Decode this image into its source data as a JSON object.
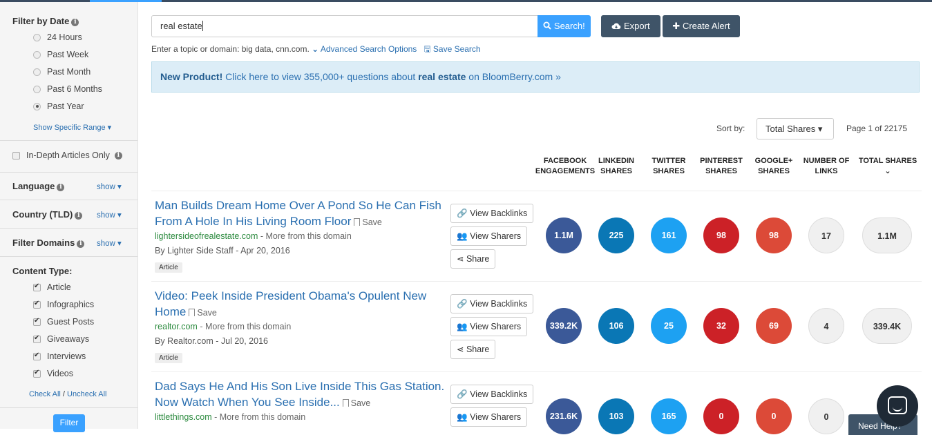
{
  "sidebar": {
    "date_heading": "Filter by Date",
    "date_options": [
      {
        "label": "24 Hours",
        "selected": false
      },
      {
        "label": "Past Week",
        "selected": false
      },
      {
        "label": "Past Month",
        "selected": false
      },
      {
        "label": "Past 6 Months",
        "selected": false
      },
      {
        "label": "Past Year",
        "selected": true
      }
    ],
    "show_range": "Show Specific Range ▾",
    "in_depth": "In-Depth Articles Only",
    "language": "Language",
    "country": "Country (TLD)",
    "filter_domains": "Filter Domains",
    "show": "show ▾",
    "content_type_heading": "Content Type:",
    "content_types": [
      "Article",
      "Infographics",
      "Guest Posts",
      "Giveaways",
      "Interviews",
      "Videos"
    ],
    "check_all": "Check All",
    "slash": " / ",
    "uncheck_all": "Uncheck All",
    "filter_button": "Filter"
  },
  "search": {
    "query": "real estate",
    "button": "Search!",
    "export": "Export",
    "create_alert": "Create Alert",
    "hint": "Enter a topic or domain: big data, cnn.com.",
    "advanced": "Advanced Search Options",
    "save": "Save Search"
  },
  "banner": {
    "new_product": "New Product!",
    "text_before": " Click here to view 355,000+ questions about ",
    "topic": "real estate",
    "text_after": " on BloomBerry.com »"
  },
  "sort": {
    "label": "Sort by:",
    "value": "Total Shares ▾",
    "page": "Page 1 of 22175"
  },
  "columns": [
    [
      "FACEBOOK",
      "ENGAGEMENTS"
    ],
    [
      "LINKEDIN",
      "SHARES"
    ],
    [
      "TWITTER",
      "SHARES"
    ],
    [
      "PINTEREST",
      "SHARES"
    ],
    [
      "GOOGLE+",
      "SHARES"
    ],
    [
      "NUMBER OF",
      "LINKS"
    ],
    [
      "TOTAL SHARES ⌄",
      ""
    ]
  ],
  "actions": {
    "backlinks": "View Backlinks",
    "sharers": "View Sharers",
    "share": "Share",
    "save": "Save",
    "more": " - More from this domain"
  },
  "results": [
    {
      "title": "Man Builds Dream Home Over A Pond So He Can Fish From A Hole In His Living Room Floor",
      "domain": "lightersideofrealestate.com",
      "byline": "By Lighter Side Staff - Apr 20, 2016",
      "type": "Article",
      "stats": [
        "1.1M",
        "225",
        "161",
        "98",
        "98",
        "17",
        "1.1M"
      ]
    },
    {
      "title": "Video: Peek Inside President Obama's Opulent New Home",
      "domain": "realtor.com",
      "byline": "By Realtor.com - Jul 20, 2016",
      "type": "Article",
      "stats": [
        "339.2K",
        "106",
        "25",
        "32",
        "69",
        "4",
        "339.4K"
      ]
    },
    {
      "title": "Dad Says He And His Son Live Inside This Gas Station. Now Watch When You See Inside...",
      "domain": "littlethings.com",
      "byline": "",
      "type": "",
      "stats": [
        "231.6K",
        "103",
        "165",
        "0",
        "0",
        "0",
        ""
      ]
    }
  ],
  "help": "Need Help?"
}
